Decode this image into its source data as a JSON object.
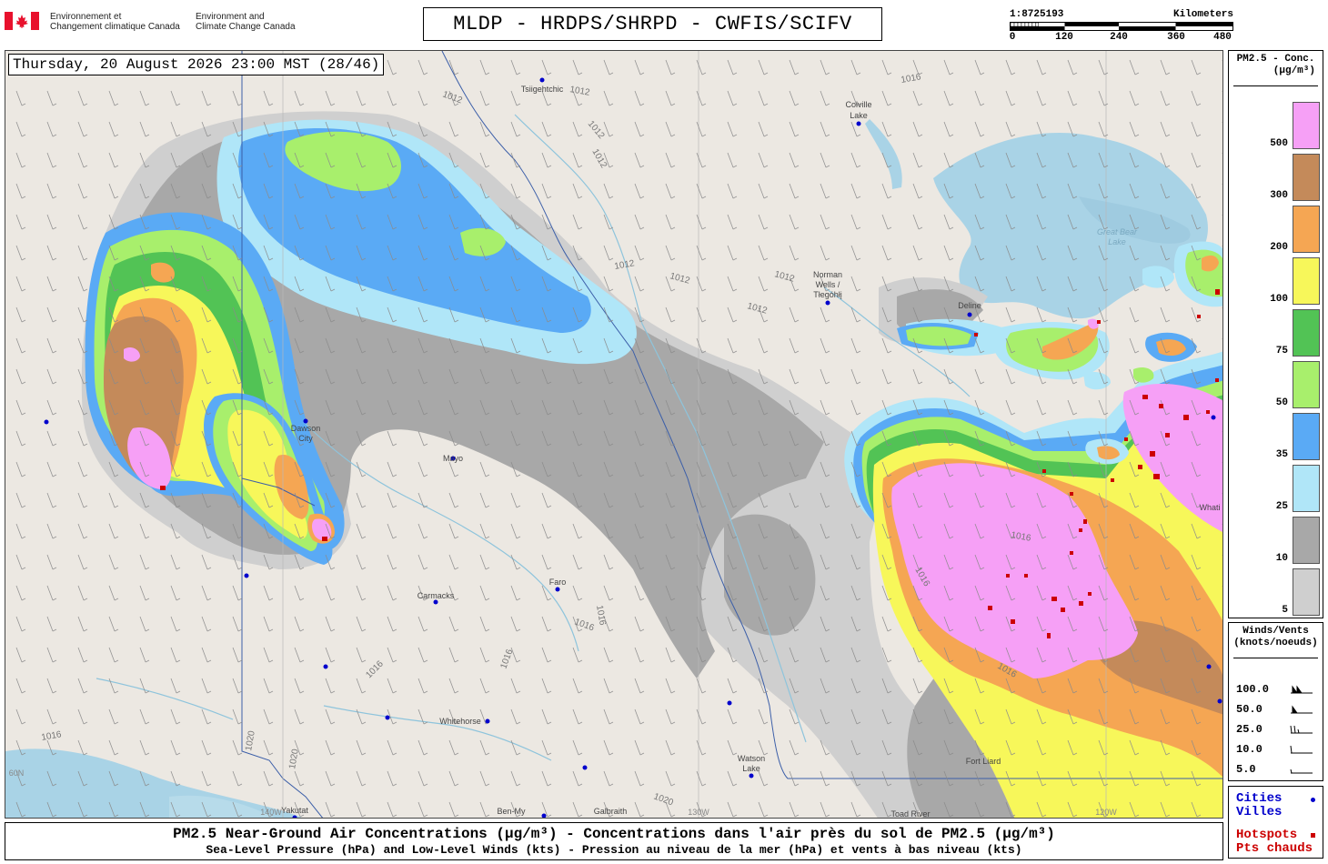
{
  "header": {
    "gov_fr_line1": "Environnement et",
    "gov_fr_line2": "Changement climatique Canada",
    "gov_en_line1": "Environment and",
    "gov_en_line2": "Climate Change Canada",
    "product_title": "MLDP - HRDPS/SHRPD - CWFIS/SCIFV"
  },
  "scale": {
    "ratio": "1:8725193",
    "unit": "Kilometers",
    "ticks": [
      "0",
      "120",
      "240",
      "360",
      "480"
    ]
  },
  "map": {
    "timestamp": "Thursday, 20 August 2026 23:00 MST (28/46)",
    "colors": {
      "land": "#ece8e2",
      "water": "#a9d3e6",
      "pm_5": "#cfcfcf",
      "pm_10": "#a8a8a8",
      "pm_25": "#b0e6f8",
      "pm_35": "#5aaaf5",
      "pm_50": "#a8ef6c",
      "pm_75": "#52c355",
      "pm_100": "#f7f75a",
      "pm_200": "#f5a653",
      "pm_300": "#c48a5a",
      "pm_500": "#f6a0f6",
      "hotspot": "#cc0000",
      "city": "#0000cc"
    },
    "cities": [
      {
        "name": "Tsiigehtchic"
      },
      {
        "name": "Colville"
      },
      {
        "name": "Lake"
      },
      {
        "name": "Norman"
      },
      {
        "name": "Wells /"
      },
      {
        "name": "Tłegóhłį"
      },
      {
        "name": "Dawson"
      },
      {
        "name": "City"
      },
      {
        "name": "Mayo"
      },
      {
        "name": "Faro"
      },
      {
        "name": "Carmacks"
      },
      {
        "name": "Whitehorse"
      },
      {
        "name": "Watson"
      },
      {
        "name": "Lake"
      },
      {
        "name": "Yakutat"
      },
      {
        "name": "Ben-My"
      },
      {
        "name": "Galbraith"
      },
      {
        "name": "Toad River"
      },
      {
        "name": "Deline"
      },
      {
        "name": "Fort Liard"
      },
      {
        "name": "Whati"
      }
    ],
    "geo_labels": [
      {
        "text": "Great Bear"
      },
      {
        "text": "Lake"
      },
      {
        "text": "130W"
      },
      {
        "text": "120W"
      },
      {
        "text": "140W"
      },
      {
        "text": "60N"
      }
    ],
    "isobars": [
      {
        "text": "1012"
      },
      {
        "text": "1012"
      },
      {
        "text": "1012"
      },
      {
        "text": "1012"
      },
      {
        "text": "1012"
      },
      {
        "text": "1012"
      },
      {
        "text": "1012"
      },
      {
        "text": "1012"
      },
      {
        "text": "1016"
      },
      {
        "text": "1016"
      },
      {
        "text": "1016"
      },
      {
        "text": "1016"
      },
      {
        "text": "1016"
      },
      {
        "text": "1016"
      },
      {
        "text": "1016"
      },
      {
        "text": "1016"
      },
      {
        "text": "1020"
      },
      {
        "text": "1020"
      },
      {
        "text": "1020"
      },
      {
        "text": "1016"
      }
    ]
  },
  "legend_pm": {
    "title_line1": "PM2.5 - Conc.",
    "title_line2": "(µg/m³)",
    "levels": [
      {
        "value": "500",
        "color": "#f6a0f6"
      },
      {
        "value": "300",
        "color": "#c48a5a"
      },
      {
        "value": "200",
        "color": "#f5a653"
      },
      {
        "value": "100",
        "color": "#f7f75a"
      },
      {
        "value": "75",
        "color": "#52c355"
      },
      {
        "value": "50",
        "color": "#a8ef6c"
      },
      {
        "value": "35",
        "color": "#5aaaf5"
      },
      {
        "value": "25",
        "color": "#b0e6f8"
      },
      {
        "value": "10",
        "color": "#a8a8a8"
      },
      {
        "value": "5",
        "color": "#cfcfcf"
      }
    ]
  },
  "legend_wind": {
    "title_line1": "Winds/Vents",
    "title_line2": "(knots/noeuds)",
    "rows": [
      {
        "value": "100.0",
        "barb": "pennant-pennant"
      },
      {
        "value": "50.0",
        "barb": "pennant"
      },
      {
        "value": "25.0",
        "barb": "two-full-half"
      },
      {
        "value": "10.0",
        "barb": "one-full"
      },
      {
        "value": "5.0",
        "barb": "half"
      }
    ]
  },
  "legend_points": {
    "cities_line1": "Cities",
    "cities_line2": "Villes",
    "hotspots_line1": "Hotspots",
    "hotspots_line2": "Pts chauds"
  },
  "footer": {
    "line1": "PM2.5 Near-Ground Air Concentrations (µg/m³) - Concentrations dans l'air près du sol de PM2.5 (µg/m³)",
    "line2": "Sea-Level Pressure (hPa) and Low-Level Winds (kts) - Pression au niveau de la mer (hPa) et vents à bas niveau (kts)"
  }
}
